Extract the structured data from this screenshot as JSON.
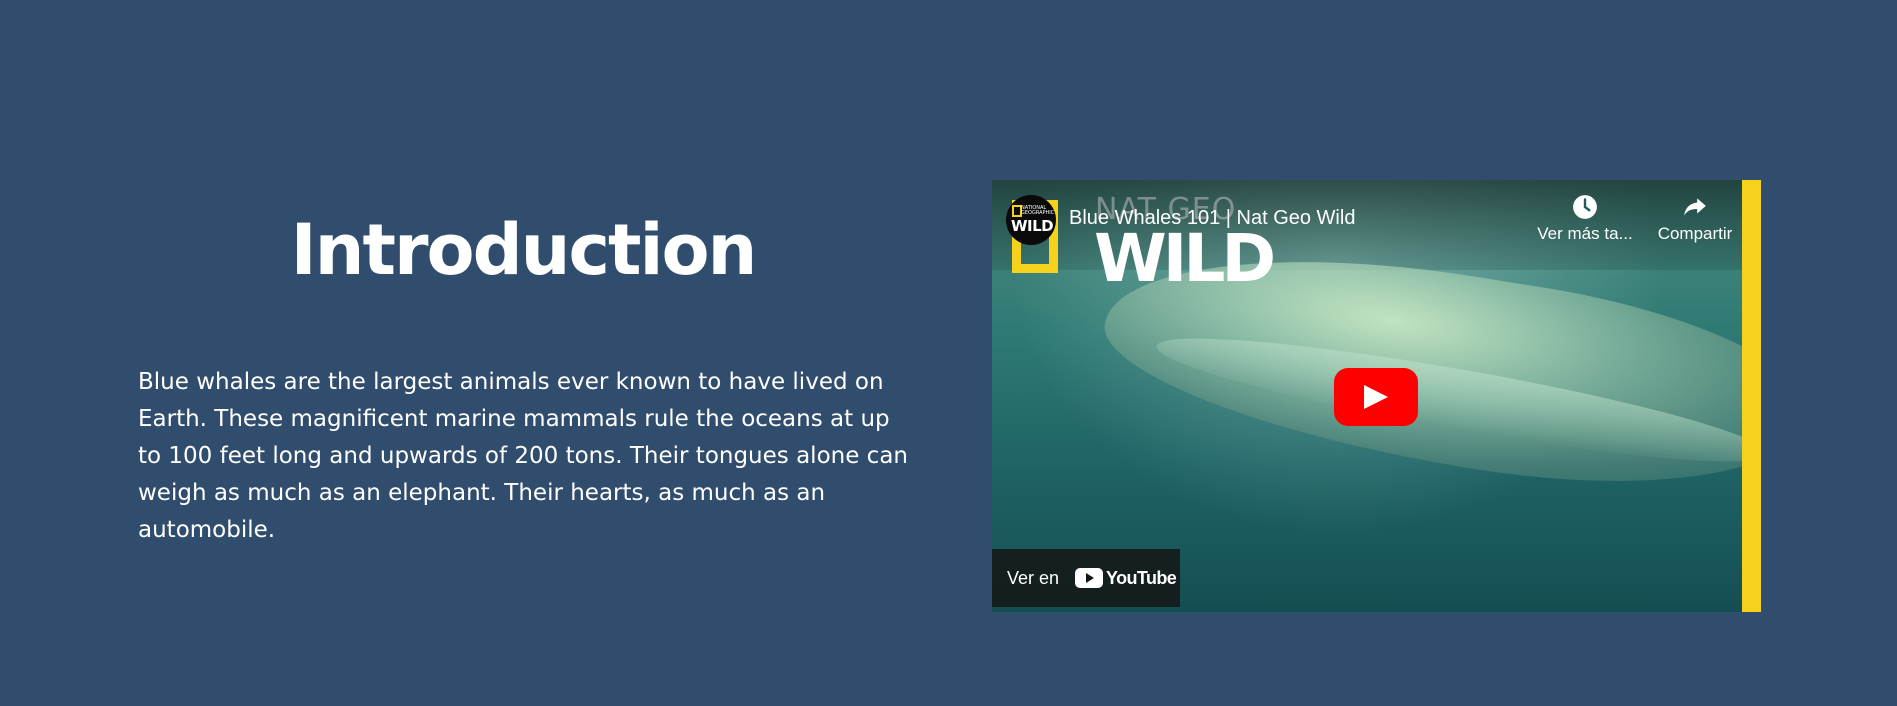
{
  "section": {
    "title": "Introduction",
    "body": "Blue whales are the largest animals ever known to have lived on Earth. These magnificent marine mammals rule the oceans at up to 100 feet long and upwards of 200 tons. Their tongues alone can weigh as much as an elephant. Their hearts, as much as an automobile."
  },
  "video": {
    "title": "Blue Whales 101 | Nat Geo Wild",
    "watermark_top": "NAT GEO",
    "watermark_main": "WILD",
    "channel_avatar_top": "NATIONAL GEOGRAPHIC",
    "channel_avatar_main": "WILD",
    "watch_later_label": "Ver más ta...",
    "share_label": "Compartir",
    "watch_on_label": "Ver en",
    "youtube_word": "YouTube",
    "icons": {
      "watch_later": "clock-icon",
      "share": "share-arrow-icon",
      "play": "play-icon",
      "youtube": "youtube-logo-icon"
    }
  },
  "colors": {
    "background": "#314d6d",
    "natgeo_yellow": "#f7d21c",
    "youtube_red": "#ff0000"
  }
}
